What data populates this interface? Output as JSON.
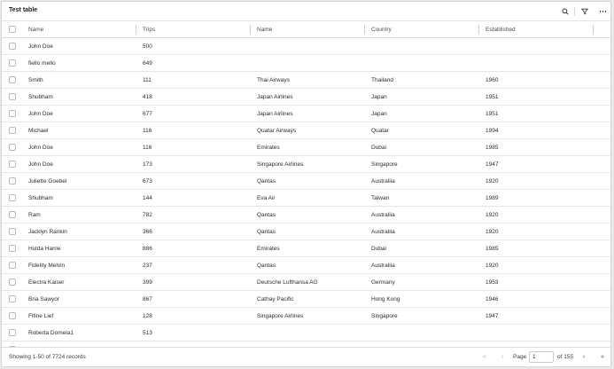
{
  "toolbar": {
    "title": "Test table",
    "search_icon": "search-icon",
    "filter_icon": "filter-icon",
    "more_icon": "more-horizontal-icon"
  },
  "columns": [
    "Name",
    "Trips",
    "Name",
    "Country",
    "Established"
  ],
  "rows": [
    {
      "name": "John Doe",
      "trips": "500",
      "airline": "",
      "country": "",
      "established": ""
    },
    {
      "name": "fiello mello",
      "trips": "649",
      "airline": "",
      "country": "",
      "established": ""
    },
    {
      "name": "Smith",
      "trips": "111",
      "airline": "Thai Airways",
      "country": "Thailand",
      "established": "1960"
    },
    {
      "name": "Shubham",
      "trips": "418",
      "airline": "Japan Airlines",
      "country": "Japan",
      "established": "1951"
    },
    {
      "name": "John Doe",
      "trips": "677",
      "airline": "Japan Airlines",
      "country": "Japan",
      "established": "1951"
    },
    {
      "name": "Michael",
      "trips": "116",
      "airline": "Quatar Airways",
      "country": "Quatar",
      "established": "1994"
    },
    {
      "name": "John Doe",
      "trips": "116",
      "airline": "Emirates",
      "country": "Dubai",
      "established": "1985"
    },
    {
      "name": "John Doe",
      "trips": "173",
      "airline": "Singapore Airlines",
      "country": "Singapore",
      "established": "1947"
    },
    {
      "name": "Juliette Goebel",
      "trips": "673",
      "airline": "Qantas",
      "country": "Australiia",
      "established": "1920"
    },
    {
      "name": "Shubham",
      "trips": "144",
      "airline": "Eva Air",
      "country": "Taiwan",
      "established": "1989"
    },
    {
      "name": "Ram",
      "trips": "782",
      "airline": "Qantas",
      "country": "Australiia",
      "established": "1920"
    },
    {
      "name": "Jacklyn Rankin",
      "trips": "366",
      "airline": "Qantas",
      "country": "Australiia",
      "established": "1920"
    },
    {
      "name": "Hulda Harrie",
      "trips": "886",
      "airline": "Emirates",
      "country": "Dubai",
      "established": "1985"
    },
    {
      "name": "Fidelity Melvin",
      "trips": "237",
      "airline": "Qantas",
      "country": "Australiia",
      "established": "1920"
    },
    {
      "name": "Electra Kaiser",
      "trips": "399",
      "airline": "Deutsche Lufthansa AG",
      "country": "Germany",
      "established": "1953"
    },
    {
      "name": "Bria Sawyor",
      "trips": "867",
      "airline": "Cathay Pacific",
      "country": "Hong Kong",
      "established": "1946"
    },
    {
      "name": "Fifine Lief",
      "trips": "128",
      "airline": "Singapore Airlines",
      "country": "Singapore",
      "established": "1947"
    },
    {
      "name": "Roberta Domela1",
      "trips": "513",
      "airline": "",
      "country": "",
      "established": ""
    },
    {
      "name": "",
      "trips": "",
      "airline": "",
      "country": "",
      "established": ""
    }
  ],
  "footer": {
    "summary": "Showing 1-50 of 7724 records",
    "page_label": "Page",
    "page_value": "1",
    "of_label": "of 155",
    "first_icon": "chevrons-left-icon",
    "prev_icon": "chevron-left-icon",
    "next_icon": "chevron-right-icon",
    "last_icon": "chevrons-right-icon"
  },
  "colors": {
    "background": "#e9e9ec",
    "surface": "#ffffff",
    "border": "#dcdce0",
    "text": "#2b2b2f"
  }
}
